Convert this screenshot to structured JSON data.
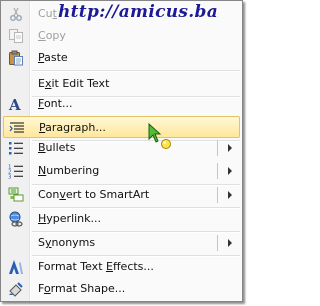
{
  "watermark": "http://amicus.ba",
  "menu": {
    "items": [
      {
        "label": "Cut",
        "icon": "scissors-icon",
        "disabled": true
      },
      {
        "label": "Copy",
        "icon": "copy-icon",
        "disabled": true
      },
      {
        "label": "Paste",
        "icon": "paste-icon",
        "disabled": false
      },
      {
        "label": "Exit Edit Text",
        "icon": "",
        "disabled": false
      },
      {
        "label": "Font...",
        "icon": "font-icon",
        "disabled": false
      },
      {
        "label": "Paragraph...",
        "icon": "paragraph-icon",
        "disabled": false,
        "hovered": true
      },
      {
        "label": "Bullets",
        "icon": "bullets-icon",
        "disabled": false,
        "submenu": true
      },
      {
        "label": "Numbering",
        "icon": "numbering-icon",
        "disabled": false,
        "submenu": true
      },
      {
        "label": "Convert to SmartArt",
        "icon": "smartart-icon",
        "disabled": false,
        "submenu": true
      },
      {
        "label": "Hyperlink...",
        "icon": "hyperlink-icon",
        "disabled": false
      },
      {
        "label": "Synonyms",
        "icon": "",
        "disabled": false,
        "submenu": true
      },
      {
        "label": "Format Text Effects...",
        "icon": "text-effects-icon",
        "disabled": false
      },
      {
        "label": "Format Shape...",
        "icon": "format-shape-icon",
        "disabled": false
      }
    ]
  },
  "colors": {
    "hover_top": "#fff8d6",
    "hover_bottom": "#ffe79a",
    "hover_border": "#e5c365",
    "disabled_text": "#a0a0a0",
    "watermark": "#1d1a96"
  }
}
